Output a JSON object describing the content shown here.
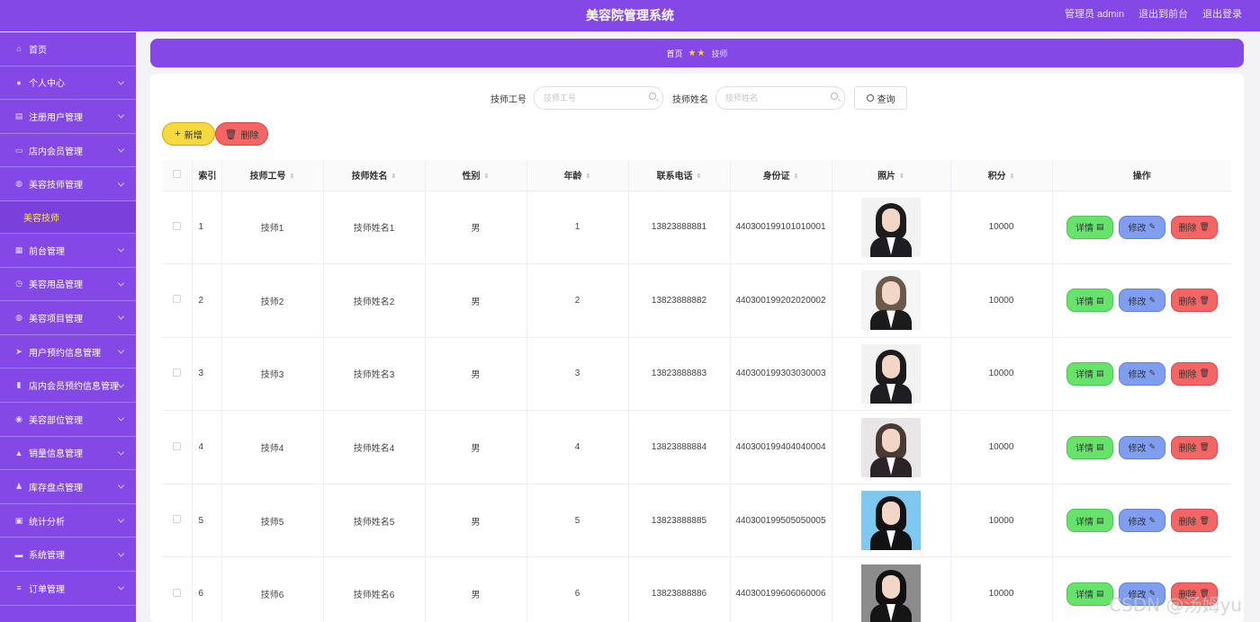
{
  "header": {
    "title": "美容院管理系统",
    "admin_label": "管理员 admin",
    "to_front": "退出到前台",
    "logout": "退出登录"
  },
  "sidebar": {
    "items": [
      {
        "label": "首页",
        "icon": "home-icon",
        "chevron": false
      },
      {
        "label": "个人中心",
        "icon": "user-icon",
        "chevron": true
      },
      {
        "label": "注册用户管理",
        "icon": "document-icon",
        "chevron": true
      },
      {
        "label": "店内会员管理",
        "icon": "monitor-icon",
        "chevron": true
      },
      {
        "label": "美容技师管理",
        "icon": "globe-icon",
        "chevron": true
      },
      {
        "label": "前台管理",
        "icon": "grid-icon",
        "chevron": true
      },
      {
        "label": "美容用品管理",
        "icon": "clock-icon",
        "chevron": true
      },
      {
        "label": "美容项目管理",
        "icon": "globe-icon",
        "chevron": true
      },
      {
        "label": "用户预约信息管理",
        "icon": "send-icon",
        "chevron": true
      },
      {
        "label": "店内会员预约信息管理",
        "icon": "bar-chart-icon",
        "chevron": true
      },
      {
        "label": "美容部位管理",
        "icon": "location-icon",
        "chevron": true
      },
      {
        "label": "销量信息管理",
        "icon": "thumb-icon",
        "chevron": true
      },
      {
        "label": "库存盘点管理",
        "icon": "person-icon",
        "chevron": true
      },
      {
        "label": "统计分析",
        "icon": "camera-icon",
        "chevron": true
      },
      {
        "label": "系统管理",
        "icon": "chat-icon",
        "chevron": true
      },
      {
        "label": "订单管理",
        "icon": "list-icon",
        "chevron": true
      }
    ],
    "submenu_active": "美容技师"
  },
  "breadcrumb": {
    "home": "首页",
    "current": "技师"
  },
  "search": {
    "field1_label": "技师工号",
    "field1_placeholder": "技师工号",
    "field2_label": "技师姓名",
    "field2_placeholder": "技师姓名",
    "query_label": "查询"
  },
  "actions": {
    "add_label": "新增",
    "delete_label": "删除"
  },
  "table": {
    "columns": [
      "索引",
      "技师工号",
      "技师姓名",
      "性别",
      "年龄",
      "联系电话",
      "身份证",
      "照片",
      "积分",
      "操作"
    ],
    "op_labels": {
      "detail": "详情",
      "edit": "修改",
      "remove": "删除"
    },
    "rows": [
      {
        "index": "1",
        "no": "技师1",
        "name": "技师姓名1",
        "gender": "男",
        "age": "1",
        "phone": "13823888881",
        "idcard": "440300199101010001",
        "points": "10000"
      },
      {
        "index": "2",
        "no": "技师2",
        "name": "技师姓名2",
        "gender": "男",
        "age": "2",
        "phone": "13823888882",
        "idcard": "440300199202020002",
        "points": "10000"
      },
      {
        "index": "3",
        "no": "技师3",
        "name": "技师姓名3",
        "gender": "男",
        "age": "3",
        "phone": "13823888883",
        "idcard": "440300199303030003",
        "points": "10000"
      },
      {
        "index": "4",
        "no": "技师4",
        "name": "技师姓名4",
        "gender": "男",
        "age": "4",
        "phone": "13823888884",
        "idcard": "440300199404040004",
        "points": "10000"
      },
      {
        "index": "5",
        "no": "技师5",
        "name": "技师姓名5",
        "gender": "男",
        "age": "5",
        "phone": "13823888885",
        "idcard": "440300199505050005",
        "points": "10000"
      },
      {
        "index": "6",
        "no": "技师6",
        "name": "技师姓名6",
        "gender": "男",
        "age": "6",
        "phone": "13823888886",
        "idcard": "440300199606060006",
        "points": "10000"
      }
    ]
  },
  "watermark": "CSDN @汤姆yu",
  "colors": {
    "brand": "#8448e6",
    "active_submenu": "#ffe24d",
    "add_button": "#f4d93f",
    "delete_button": "#f56565",
    "detail_button": "#67e26b",
    "edit_button": "#7f9ef0"
  }
}
